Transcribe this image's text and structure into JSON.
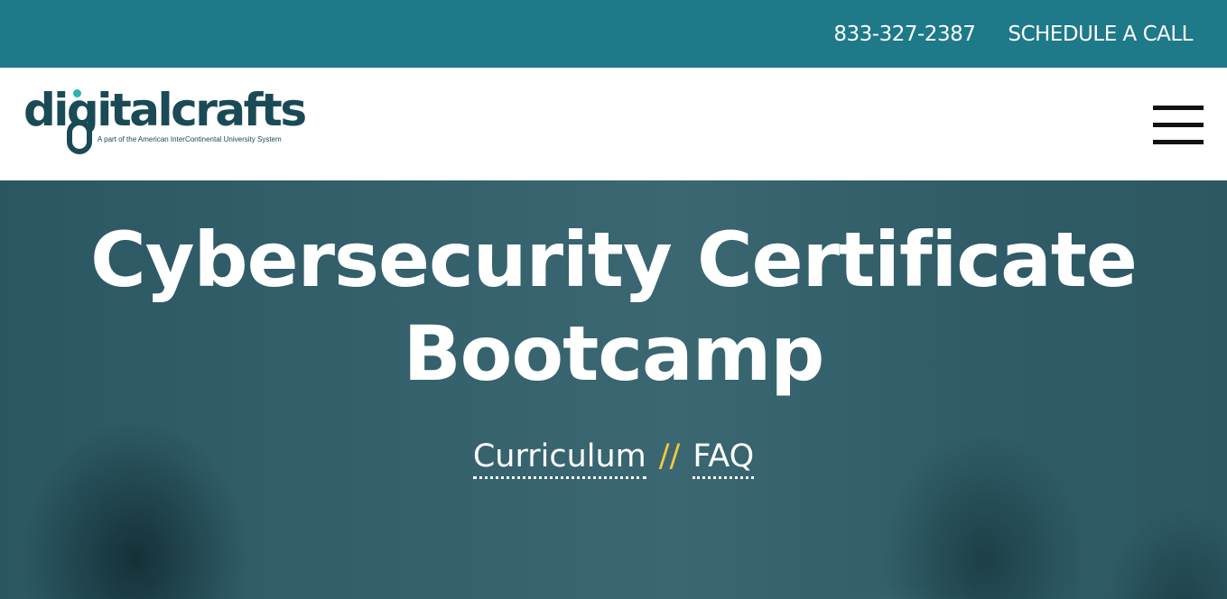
{
  "topbar": {
    "phone": "833-327-2387",
    "schedule": "SCHEDULE A CALL"
  },
  "header": {
    "logo_word": "digitalcrafts",
    "logo_tagline": "A part of the American InterContinental University System",
    "menu_icon": "hamburger-menu-icon"
  },
  "hero": {
    "title_line1": "Cybersecurity Certificate",
    "title_line2": "Bootcamp",
    "links": [
      "Curriculum",
      "FAQ"
    ],
    "separator": "//"
  },
  "colors": {
    "topbar": "#1e7989",
    "logo": "#1a4a55",
    "accent": "#f3c83c"
  }
}
